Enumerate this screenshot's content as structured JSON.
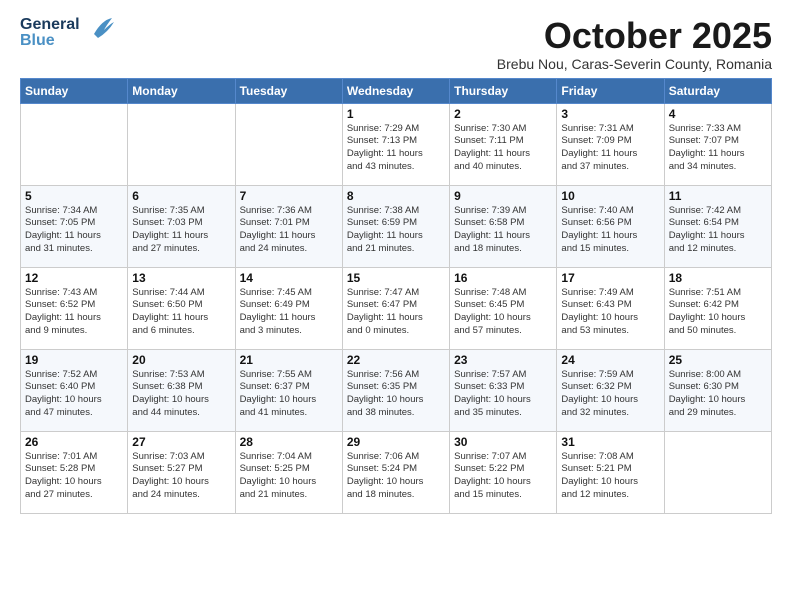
{
  "header": {
    "logo_general": "General",
    "logo_blue": "Blue",
    "month_title": "October 2025",
    "subtitle": "Brebu Nou, Caras-Severin County, Romania"
  },
  "weekdays": [
    "Sunday",
    "Monday",
    "Tuesday",
    "Wednesday",
    "Thursday",
    "Friday",
    "Saturday"
  ],
  "weeks": [
    [
      {
        "day": "",
        "info": ""
      },
      {
        "day": "",
        "info": ""
      },
      {
        "day": "",
        "info": ""
      },
      {
        "day": "1",
        "info": "Sunrise: 7:29 AM\nSunset: 7:13 PM\nDaylight: 11 hours\nand 43 minutes."
      },
      {
        "day": "2",
        "info": "Sunrise: 7:30 AM\nSunset: 7:11 PM\nDaylight: 11 hours\nand 40 minutes."
      },
      {
        "day": "3",
        "info": "Sunrise: 7:31 AM\nSunset: 7:09 PM\nDaylight: 11 hours\nand 37 minutes."
      },
      {
        "day": "4",
        "info": "Sunrise: 7:33 AM\nSunset: 7:07 PM\nDaylight: 11 hours\nand 34 minutes."
      }
    ],
    [
      {
        "day": "5",
        "info": "Sunrise: 7:34 AM\nSunset: 7:05 PM\nDaylight: 11 hours\nand 31 minutes."
      },
      {
        "day": "6",
        "info": "Sunrise: 7:35 AM\nSunset: 7:03 PM\nDaylight: 11 hours\nand 27 minutes."
      },
      {
        "day": "7",
        "info": "Sunrise: 7:36 AM\nSunset: 7:01 PM\nDaylight: 11 hours\nand 24 minutes."
      },
      {
        "day": "8",
        "info": "Sunrise: 7:38 AM\nSunset: 6:59 PM\nDaylight: 11 hours\nand 21 minutes."
      },
      {
        "day": "9",
        "info": "Sunrise: 7:39 AM\nSunset: 6:58 PM\nDaylight: 11 hours\nand 18 minutes."
      },
      {
        "day": "10",
        "info": "Sunrise: 7:40 AM\nSunset: 6:56 PM\nDaylight: 11 hours\nand 15 minutes."
      },
      {
        "day": "11",
        "info": "Sunrise: 7:42 AM\nSunset: 6:54 PM\nDaylight: 11 hours\nand 12 minutes."
      }
    ],
    [
      {
        "day": "12",
        "info": "Sunrise: 7:43 AM\nSunset: 6:52 PM\nDaylight: 11 hours\nand 9 minutes."
      },
      {
        "day": "13",
        "info": "Sunrise: 7:44 AM\nSunset: 6:50 PM\nDaylight: 11 hours\nand 6 minutes."
      },
      {
        "day": "14",
        "info": "Sunrise: 7:45 AM\nSunset: 6:49 PM\nDaylight: 11 hours\nand 3 minutes."
      },
      {
        "day": "15",
        "info": "Sunrise: 7:47 AM\nSunset: 6:47 PM\nDaylight: 11 hours\nand 0 minutes."
      },
      {
        "day": "16",
        "info": "Sunrise: 7:48 AM\nSunset: 6:45 PM\nDaylight: 10 hours\nand 57 minutes."
      },
      {
        "day": "17",
        "info": "Sunrise: 7:49 AM\nSunset: 6:43 PM\nDaylight: 10 hours\nand 53 minutes."
      },
      {
        "day": "18",
        "info": "Sunrise: 7:51 AM\nSunset: 6:42 PM\nDaylight: 10 hours\nand 50 minutes."
      }
    ],
    [
      {
        "day": "19",
        "info": "Sunrise: 7:52 AM\nSunset: 6:40 PM\nDaylight: 10 hours\nand 47 minutes."
      },
      {
        "day": "20",
        "info": "Sunrise: 7:53 AM\nSunset: 6:38 PM\nDaylight: 10 hours\nand 44 minutes."
      },
      {
        "day": "21",
        "info": "Sunrise: 7:55 AM\nSunset: 6:37 PM\nDaylight: 10 hours\nand 41 minutes."
      },
      {
        "day": "22",
        "info": "Sunrise: 7:56 AM\nSunset: 6:35 PM\nDaylight: 10 hours\nand 38 minutes."
      },
      {
        "day": "23",
        "info": "Sunrise: 7:57 AM\nSunset: 6:33 PM\nDaylight: 10 hours\nand 35 minutes."
      },
      {
        "day": "24",
        "info": "Sunrise: 7:59 AM\nSunset: 6:32 PM\nDaylight: 10 hours\nand 32 minutes."
      },
      {
        "day": "25",
        "info": "Sunrise: 8:00 AM\nSunset: 6:30 PM\nDaylight: 10 hours\nand 29 minutes."
      }
    ],
    [
      {
        "day": "26",
        "info": "Sunrise: 7:01 AM\nSunset: 5:28 PM\nDaylight: 10 hours\nand 27 minutes."
      },
      {
        "day": "27",
        "info": "Sunrise: 7:03 AM\nSunset: 5:27 PM\nDaylight: 10 hours\nand 24 minutes."
      },
      {
        "day": "28",
        "info": "Sunrise: 7:04 AM\nSunset: 5:25 PM\nDaylight: 10 hours\nand 21 minutes."
      },
      {
        "day": "29",
        "info": "Sunrise: 7:06 AM\nSunset: 5:24 PM\nDaylight: 10 hours\nand 18 minutes."
      },
      {
        "day": "30",
        "info": "Sunrise: 7:07 AM\nSunset: 5:22 PM\nDaylight: 10 hours\nand 15 minutes."
      },
      {
        "day": "31",
        "info": "Sunrise: 7:08 AM\nSunset: 5:21 PM\nDaylight: 10 hours\nand 12 minutes."
      },
      {
        "day": "",
        "info": ""
      }
    ]
  ]
}
